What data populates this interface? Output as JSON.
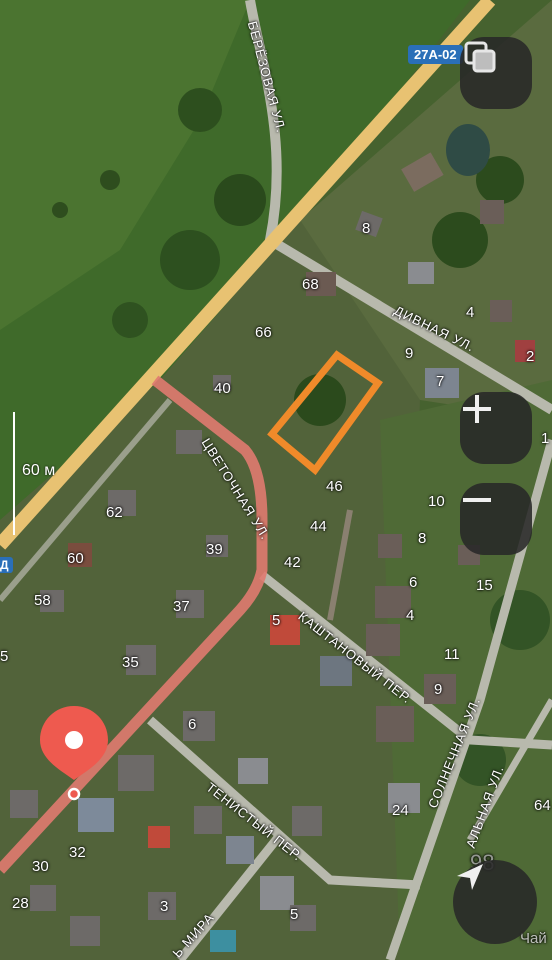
{
  "map": {
    "road_badge": "27A-02",
    "scale_label": "60 м",
    "streets": {
      "berezovaya": "БЕРЁЗОВАЯ УЛ.",
      "divnaya": "ДИВНАЯ УЛ.",
      "tsvetochnaya": "ЦВЕТОЧНАЯ УЛ.",
      "kashtanovy": "КАШТАНОВЫЙ ПЕР.",
      "solnechnaya": "СОЛНЕЧНАЯ УЛ.",
      "tenisty": "ТЕНИСТЫЙ ПЕР.",
      "mira": "Ь МИРА",
      "alnaya": "АЛЬНАЯ УЛ."
    },
    "house_numbers": [
      "8",
      "68",
      "4",
      "66",
      "9",
      "2",
      "40",
      "7",
      "1",
      "46",
      "10",
      "62",
      "44",
      "8",
      "60",
      "39",
      "42",
      "6",
      "15",
      "58",
      "37",
      "5",
      "4",
      "11",
      "35",
      "9",
      "6",
      "24",
      "64",
      "32",
      "30",
      "28",
      "3",
      "5"
    ],
    "watermark": "98",
    "partial_text": "Чай",
    "left_edge_mark": "Д",
    "left_edge_num": "5"
  },
  "controls": {
    "layers_icon": "layers-icon",
    "zoom_in_icon": "plus-icon",
    "zoom_out_icon": "minus-icon",
    "location_icon": "navigation-arrow-icon",
    "pin_icon": "location-pin-icon"
  },
  "colors": {
    "selected_plot": "#f08a2a",
    "highway": "#e8c272",
    "route": "#e07a70",
    "pin": "#ee5a4f",
    "controls_bg": "#2b2b2b"
  }
}
